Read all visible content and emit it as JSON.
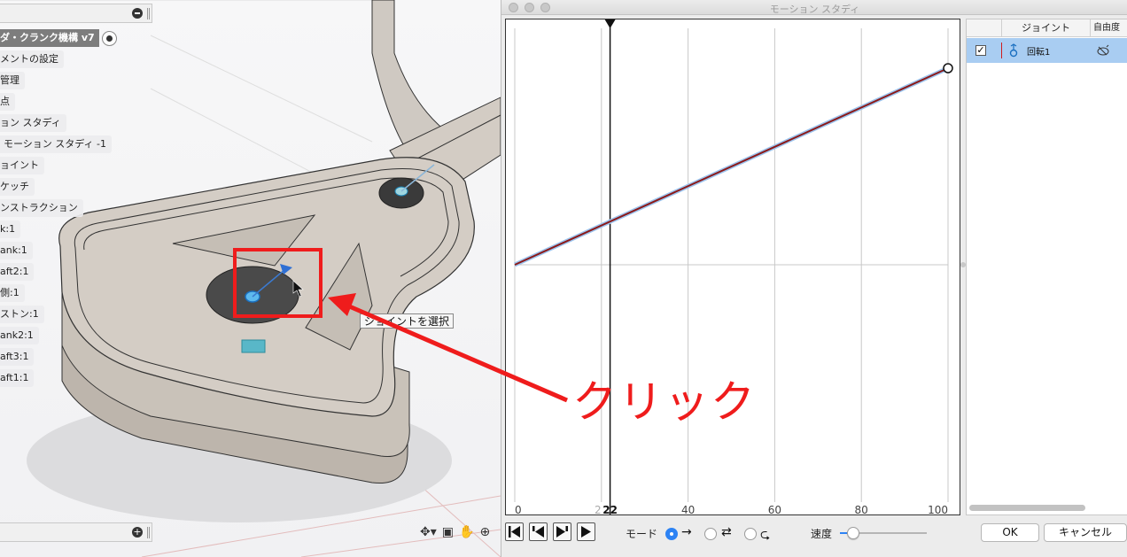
{
  "viewport": {
    "document_name": "ダ・クランク機構 v7",
    "tree_items": [
      "メントの設定",
      "管理",
      "点",
      "ョン スタディ",
      "モーション スタディ -1",
      "ョイント",
      "ケッチ",
      "ンストラクション",
      "k:1",
      "ank:1",
      "aft2:1",
      "側:1",
      "ストン:1",
      "ank2:1",
      "aft3:1",
      "aft1:1"
    ],
    "tooltip": "ジョイントを選択",
    "annotation": "クリック",
    "nav_icons": [
      "orbit-icon",
      "pan-icon",
      "hand-icon",
      "zoom-icon"
    ]
  },
  "dialog": {
    "title": "モーション スタディ",
    "graph": {
      "current_marker": "22",
      "x_ticks": [
        "0",
        "2",
        "22",
        "40",
        "60",
        "80",
        "100"
      ]
    },
    "joints_panel": {
      "headers": {
        "joint": "ジョイント",
        "dof": "自由度"
      },
      "rows": [
        {
          "checked": true,
          "name": "回転1"
        }
      ]
    },
    "mode_label": "モード",
    "speed_label": "速度",
    "ok_label": "OK",
    "cancel_label": "キャンセル",
    "speed_value": 0.15,
    "colors": {
      "accent": "#2d83f4",
      "curve": "#8b1a1a",
      "annotation": "#ef1c1c",
      "selection": "#a9cdf2"
    }
  },
  "chart_data": {
    "type": "line",
    "x": [
      0,
      100
    ],
    "series": [
      {
        "values": [
          0,
          1
        ]
      }
    ],
    "xlim": [
      0,
      100
    ],
    "x_ticks": [
      0,
      20,
      40,
      60,
      80,
      100
    ],
    "current_position": 22,
    "grid": true
  }
}
